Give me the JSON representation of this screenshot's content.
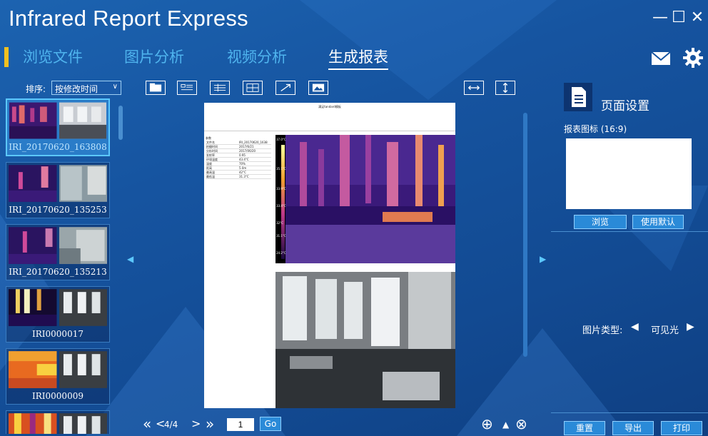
{
  "window": {
    "title": "Infrared Report Express",
    "minimize": "—",
    "maximize": "☐",
    "close": "✕"
  },
  "tabs": [
    {
      "label": "浏览文件",
      "active": false
    },
    {
      "label": "图片分析",
      "active": false
    },
    {
      "label": "视频分析",
      "active": false
    },
    {
      "label": "生成报表",
      "active": true
    }
  ],
  "header_icons": [
    "mail-icon",
    "gear-icon"
  ],
  "left_panel": {
    "sort_label": "排序:",
    "sort_value": "按修改时间",
    "files": [
      {
        "name": "IRI_20170620_163808",
        "selected": true
      },
      {
        "name": "IRI_20170620_135253",
        "selected": false
      },
      {
        "name": "IRI_20170620_135213",
        "selected": false
      },
      {
        "name": "IRI0000017",
        "selected": false
      },
      {
        "name": "IRI0000009",
        "selected": false
      },
      {
        "name": "",
        "selected": false
      }
    ]
  },
  "toolbar": {
    "buttons": [
      "folder-icon",
      "text-block-icon",
      "table-rows-icon",
      "table-grid-icon",
      "arrow-icon",
      "image-icon"
    ],
    "fit_buttons": [
      "fit-width-icon",
      "fit-height-icon"
    ]
  },
  "report": {
    "title": "满足tandard模板",
    "params_header": "参数",
    "params": [
      [
        "文件名",
        "IRI_20170620_1638"
      ],
      [
        "拍摄时间",
        "2017/6/21"
      ],
      [
        "分析时间",
        "2017/06/20"
      ],
      [
        "发射率",
        "0.95"
      ],
      [
        "环境温度",
        "43.4°C"
      ],
      [
        "湿度",
        "70%"
      ],
      [
        "距离",
        "5.0m"
      ],
      [
        "最高温",
        "42°C"
      ],
      [
        "最低温",
        "31.3°C"
      ]
    ],
    "scale_ticks": [
      "37.0°C",
      "35.1°C",
      "33.9°C",
      "33.4°C",
      "32°C",
      "31.1°C",
      "24.2°C"
    ]
  },
  "pager": {
    "first": "«",
    "prev": "<",
    "count": "4/4",
    "next": ">",
    "last": "»",
    "page_input": "1",
    "go": "Go"
  },
  "zoom": {
    "zoom_in": "⊕",
    "up": "▲",
    "close": "⊗"
  },
  "right_panel": {
    "title": "页面设置",
    "logo_label": "报表图标 (16:9)",
    "browse": "浏览",
    "use_default": "使用默认",
    "image_type_label": "图片类型:",
    "image_type_value": "可见光",
    "reset": "重置",
    "export": "导出",
    "print": "打印"
  },
  "colors": {
    "accent_yellow": "#f0c020",
    "tab_inactive": "#4fb4ee",
    "selected_thumb": "#2a7cc8"
  }
}
